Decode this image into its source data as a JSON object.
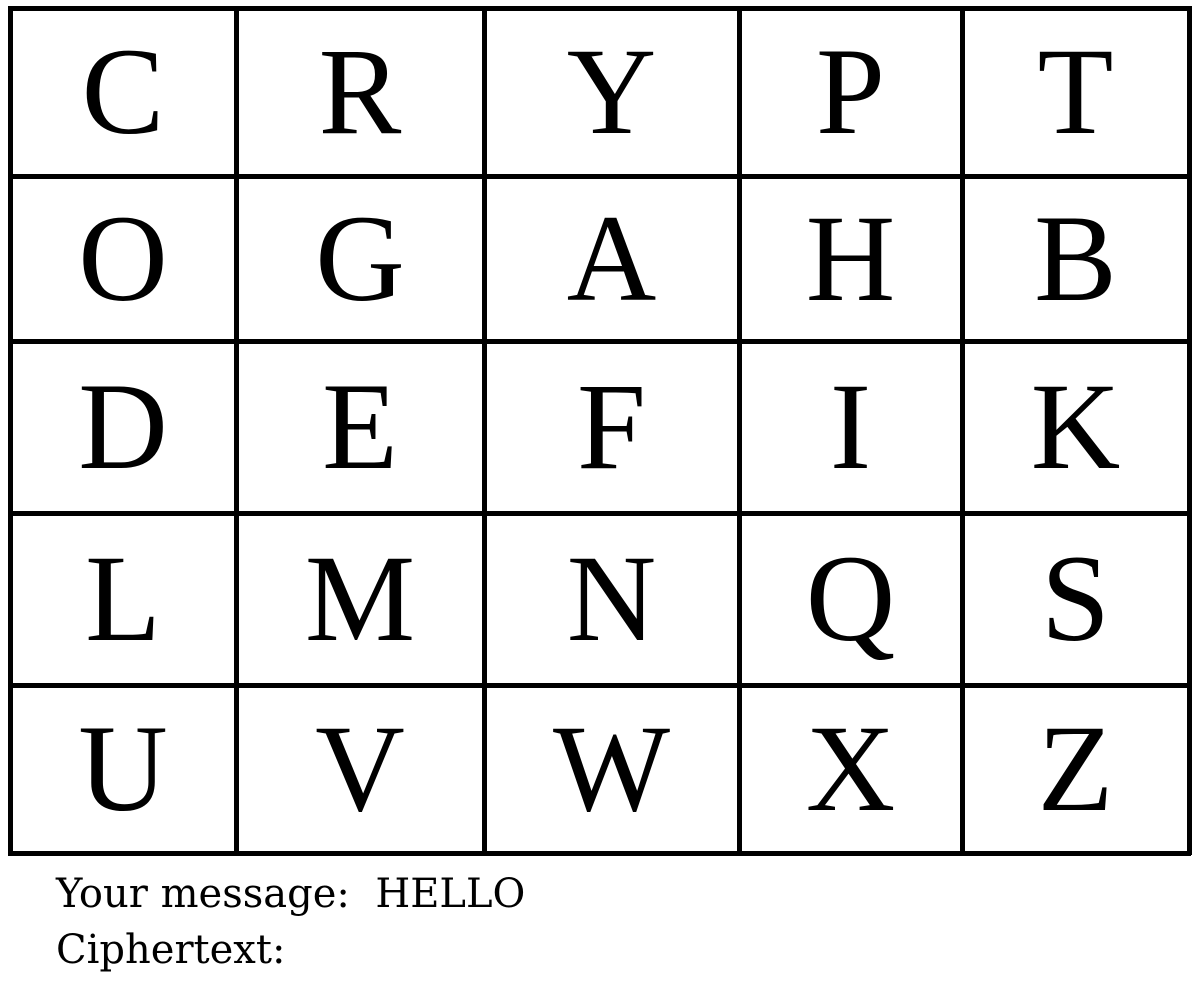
{
  "grid": {
    "rows": [
      [
        "C",
        "R",
        "Y",
        "P",
        "T"
      ],
      [
        "O",
        "G",
        "A",
        "H",
        "B"
      ],
      [
        "D",
        "E",
        "F",
        "I",
        "K"
      ],
      [
        "L",
        "M",
        "N",
        "Q",
        "S"
      ],
      [
        "U",
        "V",
        "W",
        "X",
        "Z"
      ]
    ]
  },
  "message": {
    "label": "Your message:",
    "value": "HELLO"
  },
  "ciphertext": {
    "label": "Ciphertext:",
    "value": ""
  }
}
